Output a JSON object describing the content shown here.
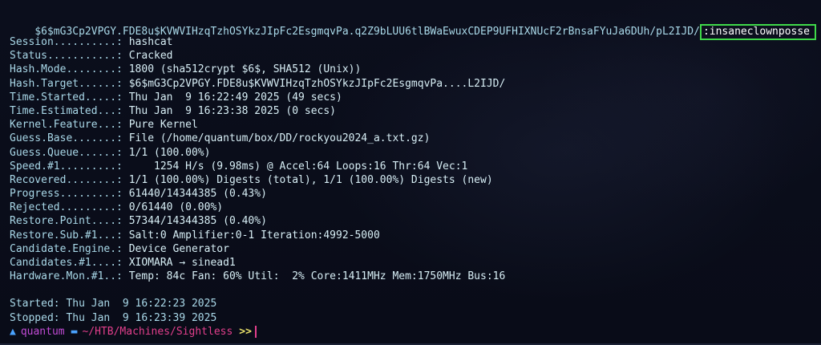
{
  "hash_line": {
    "hash": "$6$mG3Cp2VPGY.FDE8u$KVWVIHzqTzhOSYkzJIpFc2EsgmqvPa.q2Z9bLUU6tlBWaEwuxCDEP9UFHIXNUcF2rBnsaFYuJa6DUh/pL2IJD/",
    "password": ":insaneclownposse",
    "highlight_color": "#3fd94a"
  },
  "status": [
    {
      "key": "Session..........: ",
      "value": "hashcat"
    },
    {
      "key": "Status...........: ",
      "value": "Cracked"
    },
    {
      "key": "Hash.Mode........: ",
      "value": "1800 (sha512crypt $6$, SHA512 (Unix))"
    },
    {
      "key": "Hash.Target......: ",
      "value": "$6$mG3Cp2VPGY.FDE8u$KVWVIHzqTzhOSYkzJIpFc2EsgmqvPa....L2IJD/"
    },
    {
      "key": "Time.Started.....: ",
      "value": "Thu Jan  9 16:22:49 2025 (49 secs)"
    },
    {
      "key": "Time.Estimated...: ",
      "value": "Thu Jan  9 16:23:38 2025 (0 secs)"
    },
    {
      "key": "Kernel.Feature...: ",
      "value": "Pure Kernel"
    },
    {
      "key": "Guess.Base.......: ",
      "value": "File (/home/quantum/box/DD/rockyou2024_a.txt.gz)"
    },
    {
      "key": "Guess.Queue......: ",
      "value": "1/1 (100.00%)"
    },
    {
      "key": "Speed.#1.........: ",
      "value": "    1254 H/s (9.98ms) @ Accel:64 Loops:16 Thr:64 Vec:1"
    },
    {
      "key": "Recovered........: ",
      "value": "1/1 (100.00%) Digests (total), 1/1 (100.00%) Digests (new)"
    },
    {
      "key": "Progress.........: ",
      "value": "61440/14344385 (0.43%)"
    },
    {
      "key": "Rejected.........: ",
      "value": "0/61440 (0.00%)"
    },
    {
      "key": "Restore.Point....: ",
      "value": "57344/14344385 (0.40%)"
    },
    {
      "key": "Restore.Sub.#1...: ",
      "value": "Salt:0 Amplifier:0-1 Iteration:4992-5000"
    },
    {
      "key": "Candidate.Engine.: ",
      "value": "Device Generator"
    },
    {
      "key": "Candidates.#1....: ",
      "value": "XIOMARA → sinead1"
    },
    {
      "key": "Hardware.Mon.#1..: ",
      "value": "Temp: 84c Fan: 60% Util:  2% Core:1411MHz Mem:1750MHz Bus:16"
    }
  ],
  "footer": {
    "started": "Started: Thu Jan  9 16:22:23 2025",
    "stopped": "Stopped: Thu Jan  9 16:23:39 2025"
  },
  "prompt": {
    "arch_icon": "arch-linux-icon",
    "user": "quantum",
    "folder_icon": "folder-icon",
    "path": "~/HTB/Machines/Sightless",
    "arrow": ">>"
  }
}
